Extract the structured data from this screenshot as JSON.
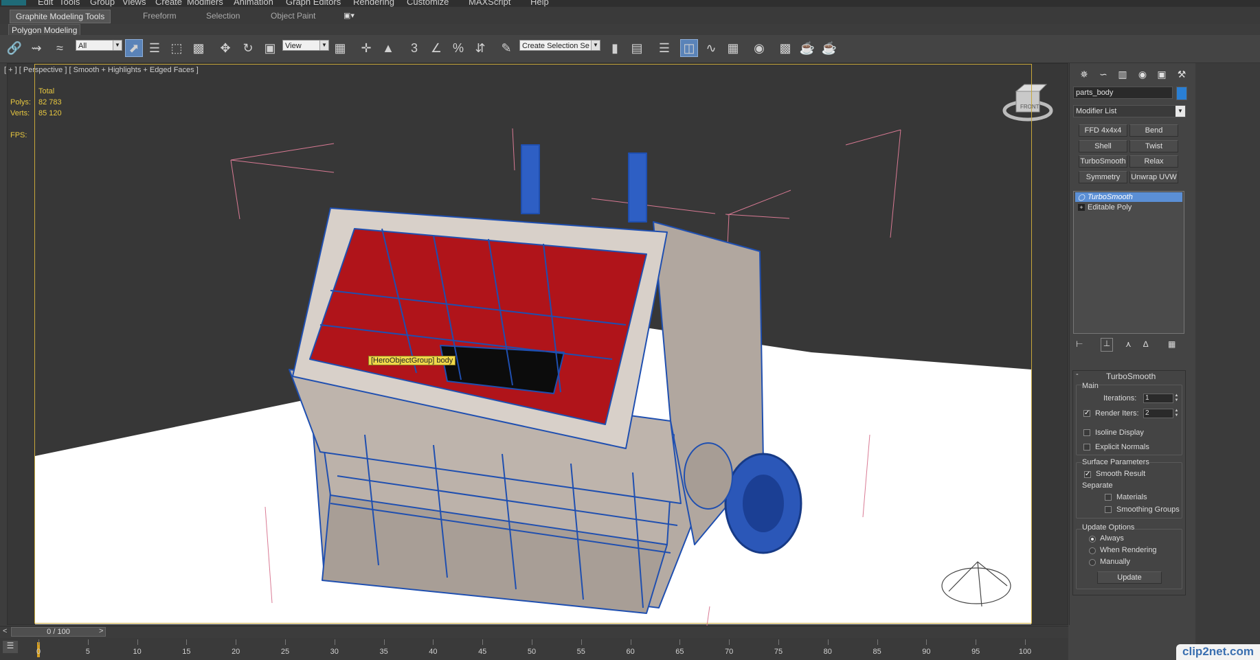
{
  "menu": [
    "Edit",
    "Tools",
    "Group",
    "Views",
    "Create",
    "Modifiers",
    "Animation",
    "Graph Editors",
    "Rendering",
    "Customize",
    "MAXScript",
    "Help"
  ],
  "ribbon": {
    "tabs": [
      "Graphite Modeling Tools",
      "Freeform",
      "Selection",
      "Object Paint"
    ],
    "panel_label": "Polygon Modeling"
  },
  "toolbar": {
    "filter_value": "All",
    "coord_value": "View",
    "selection_set_placeholder": "Create Selection Se",
    "snap_label": "3"
  },
  "viewport": {
    "label": "[ + ] [ Perspective ] [ Smooth + Highlights + Edged Faces ]",
    "stats": {
      "header": "Total",
      "polys_label": "Polys:",
      "polys_value": "82 783",
      "verts_label": "Verts:",
      "verts_value": "85 120",
      "fps_label": "FPS:"
    },
    "tooltip": "[HeroObjectGroup] body",
    "viewcube_label": "FRONT"
  },
  "command_panel": {
    "object_name": "parts_body",
    "object_color": "#2a7fd4",
    "modifier_list": "Modifier List",
    "modifier_buttons": [
      "FFD 4x4x4",
      "Bend",
      "Shell",
      "Twist",
      "TurboSmooth",
      "Relax",
      "Symmetry",
      "Unwrap UVW"
    ],
    "stack": [
      "TurboSmooth",
      "Editable Poly"
    ],
    "turbosmooth": {
      "title": "TurboSmooth",
      "main_label": "Main",
      "iterations_label": "Iterations:",
      "iterations_value": "1",
      "render_iters_label": "Render Iters:",
      "render_iters_value": "2",
      "render_iters_checked": true,
      "isoline_label": "Isoline Display",
      "explicit_label": "Explicit Normals",
      "surface_label": "Surface Parameters",
      "smooth_result_label": "Smooth Result",
      "separate_label": "Separate",
      "materials_label": "Materials",
      "smoothing_groups_label": "Smoothing Groups",
      "update_options_label": "Update Options",
      "update_always": "Always",
      "update_rendering": "When Rendering",
      "update_manually": "Manually",
      "update_button": "Update"
    }
  },
  "timeline": {
    "frame_display": "0 / 100",
    "prev_label": "<",
    "next_label": ">",
    "ticks": [
      "0",
      "5",
      "10",
      "15",
      "20",
      "25",
      "30",
      "35",
      "40",
      "45",
      "50",
      "55",
      "60",
      "65",
      "70",
      "75",
      "80",
      "85",
      "90",
      "95",
      "100"
    ]
  },
  "watermark": "clip2net.com",
  "colors": {
    "accent": "#5b8fd5",
    "viewport_border": "#c9a83a",
    "stat_text": "#e8c840",
    "wire_blue": "#1f4fb0",
    "hopper_red": "#b0141a"
  }
}
